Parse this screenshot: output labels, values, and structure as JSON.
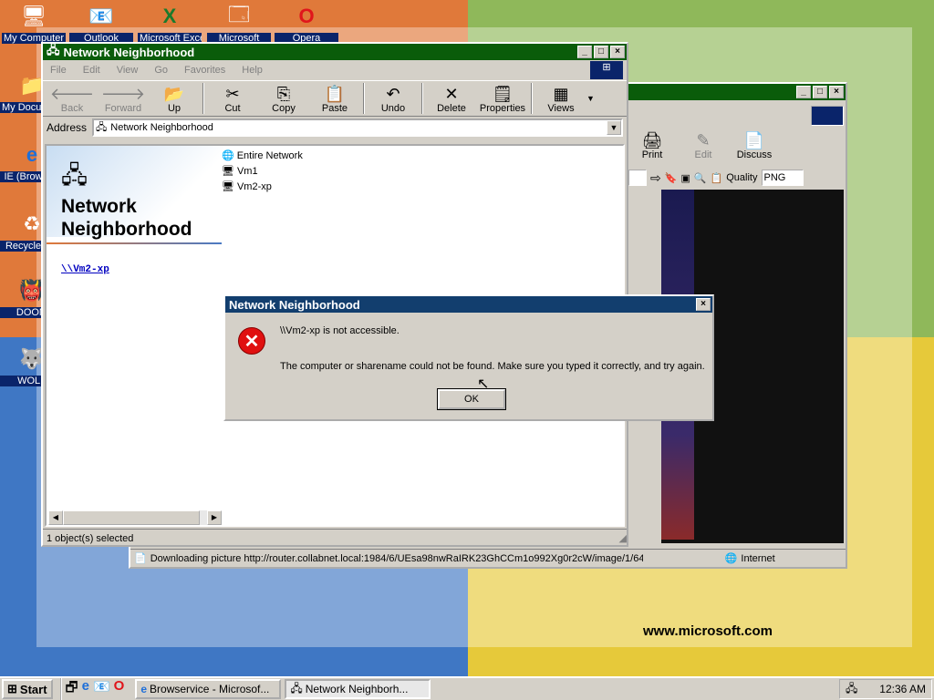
{
  "desktop": {
    "icons": [
      {
        "label": "My Computer",
        "icon": "computer-icon"
      },
      {
        "label": "My Documents",
        "icon": "folder-icon"
      },
      {
        "label": "IE (Browser)",
        "icon": "ie-icon"
      },
      {
        "label": "Recycle Bin",
        "icon": "recycle-bin-icon"
      },
      {
        "label": "DOOM",
        "icon": "doom-icon"
      },
      {
        "label": "WOLF",
        "icon": "wolf-icon"
      }
    ],
    "top_icons": [
      {
        "label": "Outlook",
        "icon": "outlook-icon"
      },
      {
        "label": "Microsoft Excel",
        "icon": "excel-icon"
      },
      {
        "label": "Microsoft",
        "icon": "app-icon"
      },
      {
        "label": "Opera",
        "icon": "opera-icon"
      }
    ],
    "wallpaper_url_text": "www.microsoft.com"
  },
  "browser_window": {
    "toolbar": {
      "print": "Print",
      "edit": "Edit",
      "discuss": "Discuss"
    },
    "quality_label": "Quality",
    "quality_value": "PNG",
    "status_text": "Downloading picture http://router.collabnet.local:1984/6/UEsa98nwRaIRK23GhCCm1o992Xg0r2cW/image/1/64",
    "zone": "Internet"
  },
  "explorer_window": {
    "title": "Network Neighborhood",
    "menu": [
      "File",
      "Edit",
      "View",
      "Go",
      "Favorites",
      "Help"
    ],
    "toolbar": [
      {
        "label": "Back",
        "icon": "back-arrow-icon",
        "disabled": true
      },
      {
        "label": "Forward",
        "icon": "forward-arrow-icon",
        "disabled": true
      },
      {
        "label": "Up",
        "icon": "up-folder-icon",
        "disabled": false
      },
      {
        "label": "Cut",
        "icon": "scissors-icon",
        "disabled": false
      },
      {
        "label": "Copy",
        "icon": "copy-icon",
        "disabled": false
      },
      {
        "label": "Paste",
        "icon": "paste-icon",
        "disabled": false
      },
      {
        "label": "Undo",
        "icon": "undo-icon",
        "disabled": false
      },
      {
        "label": "Delete",
        "icon": "delete-x-icon",
        "disabled": false
      },
      {
        "label": "Properties",
        "icon": "properties-icon",
        "disabled": false
      },
      {
        "label": "Views",
        "icon": "views-icon",
        "disabled": false
      }
    ],
    "address_label": "Address",
    "address_value": "Network Neighborhood",
    "panel_title": "Network Neighborhood",
    "panel_link": "\\\\Vm2-xp",
    "items": [
      "Entire Network",
      "Vm1",
      "Vm2-xp"
    ],
    "status_text": "1 object(s) selected"
  },
  "dialog": {
    "title": "Network Neighborhood",
    "line1": "\\\\Vm2-xp is not accessible.",
    "line2": "The computer or sharename could not be found. Make sure you typed it correctly, and try again.",
    "ok_label": "OK"
  },
  "taskbar": {
    "start_label": "Start",
    "tasks": [
      {
        "label": "Browservice - Microsof...",
        "active": false
      },
      {
        "label": "Network Neighborh...",
        "active": true
      }
    ],
    "clock": "12:36 AM"
  },
  "colors": {
    "title_active": "#0a5c0a",
    "dialog_title": "#123e6e",
    "error_red": "#e01010"
  }
}
